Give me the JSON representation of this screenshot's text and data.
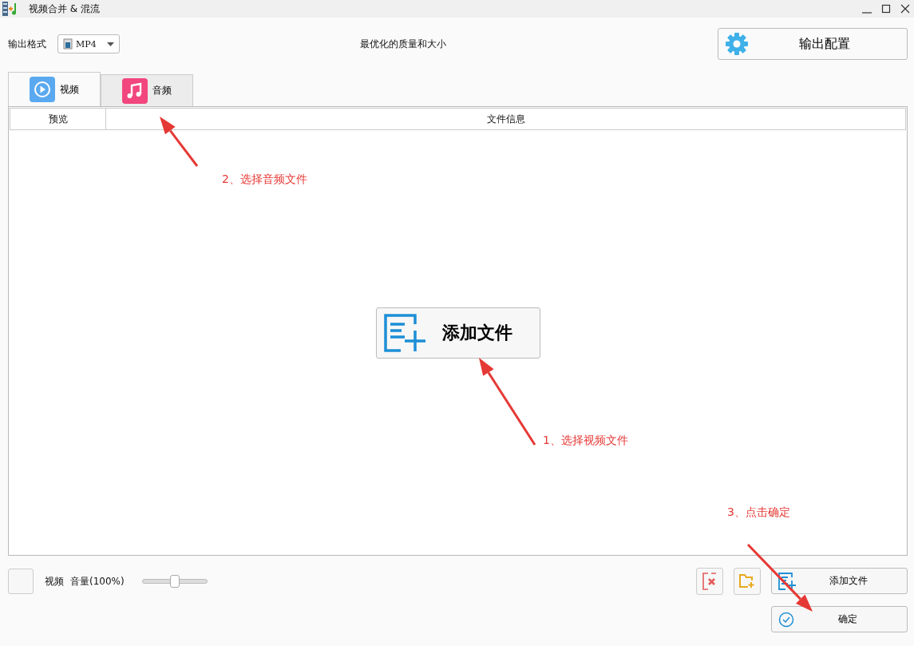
{
  "window": {
    "title": "视频合并 & 混流"
  },
  "toolbar": {
    "format_label": "输出格式",
    "format_value": "MP4",
    "quality_text": "最优化的质量和大小",
    "config_button": "输出配置"
  },
  "tabs": [
    {
      "label": "视频",
      "kind": "video",
      "selected": true
    },
    {
      "label": "音频",
      "kind": "audio",
      "selected": false
    }
  ],
  "table": {
    "columns": [
      "预览",
      "文件信息"
    ]
  },
  "center_button": "添加文件",
  "bottom": {
    "checked": false,
    "track_label": "视频",
    "volume_label": "音量(100%)",
    "volume": {
      "level": 0.5
    },
    "add_button": "添加文件",
    "ok_button": "确定"
  },
  "annotations": [
    {
      "text": "2、选择音频文件",
      "kind": "tabs"
    },
    {
      "text": "1、选择视频文件",
      "kind": "center"
    },
    {
      "text": "3、点击确定",
      "kind": "ok"
    }
  ]
}
